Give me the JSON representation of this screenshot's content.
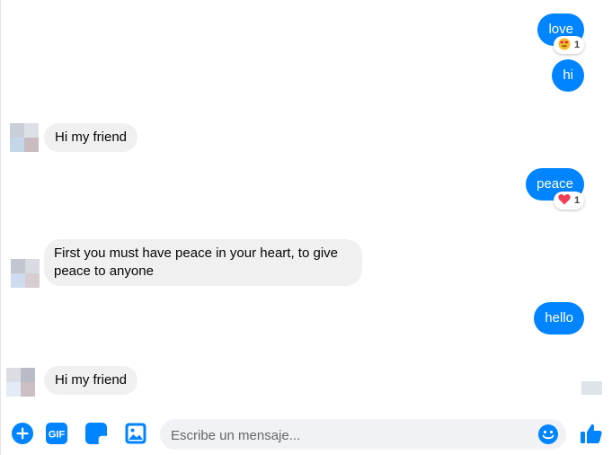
{
  "messages": [
    {
      "direction": "out",
      "text": "love",
      "reaction": {
        "emoji": "heart-eyes",
        "count": "1"
      }
    },
    {
      "direction": "out",
      "text": "hi"
    },
    {
      "direction": "in",
      "text": "Hi my friend"
    },
    {
      "direction": "out",
      "text": "peace",
      "reaction": {
        "emoji": "heart",
        "count": "1"
      }
    },
    {
      "direction": "in",
      "text": "First you must have peace in your heart, to give peace to anyone"
    },
    {
      "direction": "out",
      "text": "hello"
    },
    {
      "direction": "in",
      "text": "Hi my friend"
    }
  ],
  "composer": {
    "placeholder": "Escribe un mensaje...",
    "value": "",
    "gif_label": "GIF"
  },
  "colors": {
    "accent": "#0084ff",
    "incoming_bubble": "#f0f0f0",
    "outgoing_text": "#ffffff"
  },
  "icons": [
    "plus-circle-icon",
    "gif-icon",
    "sticker-icon",
    "image-icon",
    "emoji-icon",
    "thumbs-up-icon",
    "heart-eyes-icon",
    "heart-icon"
  ]
}
